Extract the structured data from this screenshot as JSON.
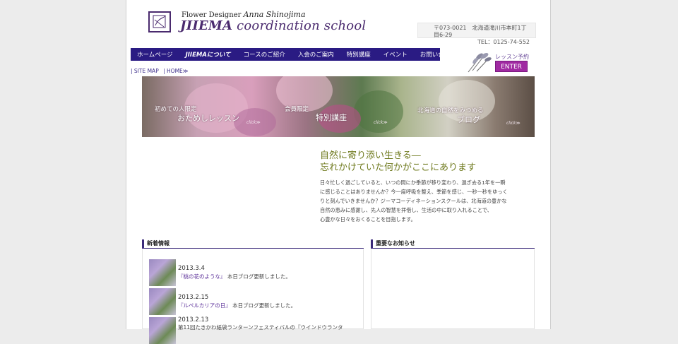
{
  "header": {
    "designer_prefix": "Flower Designer",
    "designer_name": "Anna Shinojima",
    "school_bold": "JIIEMA",
    "school_rest": " coordination school",
    "address_line": "〒073-0021　北海道滝川市本町1丁目6-29",
    "tel_line": "TEL：0125-74-552"
  },
  "nav": {
    "items": [
      "ホームページ",
      "JIIEMAについて",
      "コースのご紹介",
      "入会のご案内",
      "特別講座",
      "イベント",
      "お問い合わせ"
    ]
  },
  "lesson": {
    "label": "レッスン予約",
    "button": "ENTER"
  },
  "breadcrumb": {
    "sitemap": "| SITE MAP",
    "home": "| HOME≫"
  },
  "banner": {
    "panel1_small": "初めての人限定",
    "panel1_large": "おためしレッスン",
    "panel2_small": "会員限定",
    "panel2_large": "特別講座",
    "panel3_small": "北海道の自然をみつめる",
    "panel3_large": "ブログ",
    "click_label": "click≫"
  },
  "main": {
    "tagline_1": "自然に寄り添い生きる―",
    "tagline_2": "忘れかけていた何かがここにあります",
    "intro_lines": [
      "日々忙しく過ごしていると、いつの間にか季節が移り変わり、過ぎ去る1年を一瞬",
      "に感じることはありませんか？今一度呼吸を整え、季節を感じ、一秒一秒をゆっく",
      "りと刻んでいきませんか？ジーマコーディネーションスクールは、北海道の豊かな",
      "自然の恵みに感謝し、先人の智慧を拝借し、生活の中に取り入れることで、",
      "心豊かな日々をおくることを目指します。"
    ]
  },
  "news": {
    "heading": "新着情報",
    "items": [
      {
        "date": "2013.3.4",
        "link": "『桃の花のような』",
        "text": " 本日ブログ更新しました。"
      },
      {
        "date": "2013.2.15",
        "link": "『ルペルカリアの日』",
        "text": " 本日ブログ更新しました。"
      },
      {
        "date": "2013.2.13",
        "link": "",
        "text": "第11回たきかわ紙袋ランターンフェスティバルの『ウインドウランタ"
      }
    ]
  },
  "notice": {
    "heading": "重要なお知らせ"
  },
  "colors": {
    "nav": "#2a1b83",
    "accent": "#4a2a6e",
    "enter": "#a02aa2",
    "tagline": "#6f7a1e"
  }
}
